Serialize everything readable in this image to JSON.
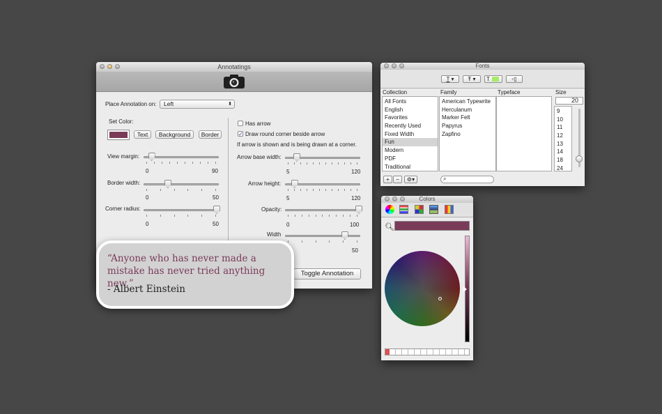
{
  "annotatings": {
    "title": "Annotatings",
    "place_label": "Place Annotation on:",
    "place_value": "Left",
    "set_color_label": "Set Color:",
    "swatch_color": "#7a3b59",
    "color_buttons": [
      "Text",
      "Background",
      "Border"
    ],
    "sliders_left": [
      {
        "label": "View margin:",
        "min": "0",
        "max": "90",
        "value": 0.1
      },
      {
        "label": "Border width:",
        "min": "0",
        "max": "50",
        "value": 0.32
      },
      {
        "label": "Corner radius:",
        "min": "0",
        "max": "50",
        "value": 0.98
      }
    ],
    "has_arrow": {
      "label": "Has arrow",
      "checked": false
    },
    "round_corner": {
      "label": "Draw round corner beside arrow",
      "checked": true
    },
    "hint": "If arrow is shown and is being drawn at a corner.",
    "sliders_right": [
      {
        "label": "Arrow base width:",
        "min": "5",
        "max": "120",
        "value": 0.15
      },
      {
        "label": "Arrow height:",
        "min": "5",
        "max": "120",
        "value": 0.12
      },
      {
        "label": "Opacity:",
        "min": "0",
        "max": "100",
        "value": 0.99
      },
      {
        "label": "Width",
        "min": "",
        "max": "50",
        "value": 0.8
      }
    ],
    "toggle_button": "Toggle Annotation"
  },
  "annotation": {
    "quote": "“Anyone who has never made a mistake has never tried anything new.”",
    "author": "- Albert Einstein",
    "quote_color": "#7a3b59"
  },
  "fonts": {
    "title": "Fonts",
    "columns": [
      "Collection",
      "Family",
      "Typeface",
      "Size"
    ],
    "collections": [
      "All Fonts",
      "English",
      "Favorites",
      "Recently Used",
      "Fixed Width",
      "Fun",
      "Modern",
      "PDF",
      "Traditional"
    ],
    "selected_collection": "Fun",
    "families": [
      "American Typewrite",
      "Herculanum",
      "Marker Felt",
      "Papyrus",
      "Zapfino"
    ],
    "size_value": "20",
    "sizes": [
      "9",
      "10",
      "11",
      "12",
      "13",
      "14",
      "18",
      "24"
    ],
    "toolbar": {
      "underline": "T",
      "strike": "Ŧ",
      "textcolor": "T",
      "doc": ""
    },
    "add_label": "+",
    "remove_label": "−",
    "gear_label": "⚙▾"
  },
  "colors": {
    "title": "Colors",
    "current_color": "#7a3b59",
    "toolbar_icons": [
      "color-wheel-icon",
      "color-sliders-icon",
      "color-palettes-icon",
      "image-palettes-icon",
      "crayons-icon"
    ]
  }
}
